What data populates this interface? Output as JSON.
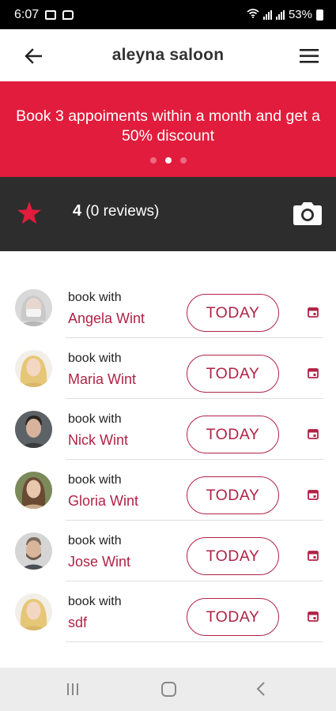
{
  "status": {
    "time": "6:07",
    "battery": "53%"
  },
  "header": {
    "title": "aleyna saloon"
  },
  "promo": {
    "text": "Book 3 appoiments within a month and get a 50% discount",
    "active_dot": 1,
    "dot_count": 3
  },
  "rating": {
    "value": "4",
    "reviews": "(0 reviews)"
  },
  "staff": [
    {
      "book_label": "book with",
      "name": "Angela Wint",
      "button": "TODAY"
    },
    {
      "book_label": "book with",
      "name": "Maria Wint",
      "button": "TODAY"
    },
    {
      "book_label": "book with",
      "name": "Nick Wint",
      "button": "TODAY"
    },
    {
      "book_label": "book with",
      "name": "Gloria Wint",
      "button": "TODAY"
    },
    {
      "book_label": "book with",
      "name": "Jose Wint",
      "button": "TODAY"
    },
    {
      "book_label": "book with",
      "name": "sdf",
      "button": "TODAY"
    }
  ],
  "colors": {
    "accent": "#e21c3c",
    "name": "#b02346",
    "rating_bg": "#2d2d2d"
  }
}
